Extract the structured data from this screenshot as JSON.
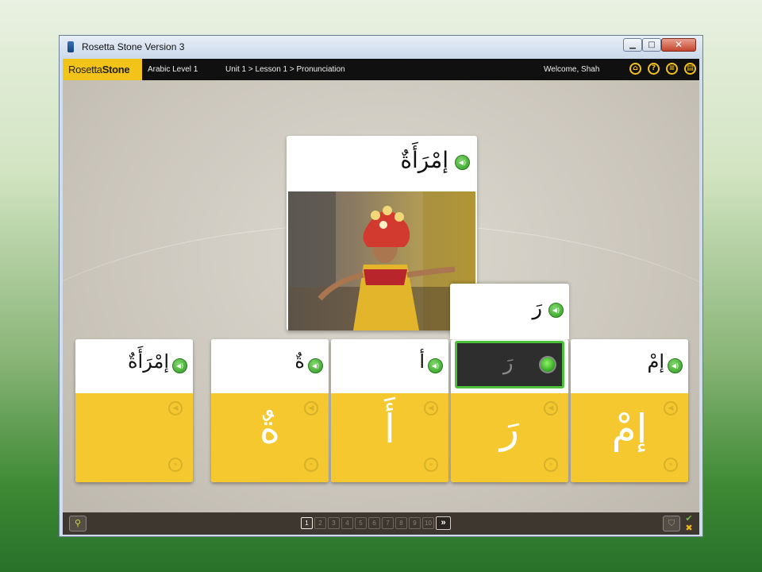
{
  "window": {
    "title": "Rosetta Stone Version 3",
    "minimize": "▁",
    "maximize": "□",
    "close": "✕"
  },
  "appbar": {
    "logo_main": "Rosetta",
    "logo_rest": "Stone",
    "course": "Arabic Level 1",
    "breadcrumb": "Unit 1 > Lesson 1 > Pronunciation",
    "welcome": "Welcome, Shah",
    "icons": [
      "home-icon",
      "help-icon",
      "menu-icon",
      "options-icon"
    ]
  },
  "main_card": {
    "word": "إمْرَأَةٌ",
    "image_alt": "woman dancer"
  },
  "cards": [
    {
      "word": "إمْرَأَةٌ",
      "syllable": ""
    },
    {
      "word": "ةٌ",
      "syllable": "ةٌ"
    },
    {
      "word": "أ",
      "syllable": "أَ"
    },
    {
      "word": "رَ",
      "syllable": "رَ"
    },
    {
      "word": "إمْ",
      "syllable": "إمْ"
    }
  ],
  "popup": {
    "word": "رَ",
    "recording_hint": "رَ"
  },
  "pager": {
    "pages": [
      "1",
      "2",
      "3",
      "4",
      "5",
      "6",
      "7",
      "8",
      "9",
      "10"
    ],
    "current": "1",
    "next": "»"
  },
  "colors": {
    "accent": "#f2c318",
    "card_yellow": "#f4c82e",
    "speaker_green": "#3aa82a"
  }
}
